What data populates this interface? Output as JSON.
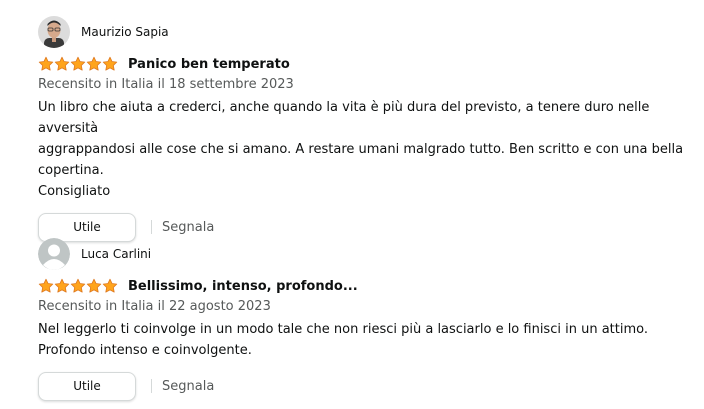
{
  "colors": {
    "star": "#ffa41c",
    "text": "#0f1111",
    "muted": "#565959",
    "button_border": "#d5d9d9"
  },
  "reviews": [
    {
      "author": "Maurizio Sapia",
      "rating": 5,
      "title": "Panico ben temperato",
      "date": "Recensito in Italia il 18 settembre 2023",
      "body_lines": [
        "Un libro che aiuta a crederci, anche quando la vita è più dura del previsto, a tenere duro nelle avversità",
        "aggrappandosi alle cose che si amano. A restare umani malgrado tutto. Ben scritto e con una bella",
        "copertina.",
        "Consigliato"
      ],
      "helpful_label": "Utile",
      "report_label": "Segnala"
    },
    {
      "author": "Luca Carlini",
      "rating": 5,
      "title": "Bellissimo, intenso, profondo...",
      "date": "Recensito in Italia il 22 agosto 2023",
      "body_lines": [
        "Nel leggerlo ti coinvolge in un modo tale che non riesci più a lasciarlo e lo finisci in un attimo.",
        "Profondo intenso e coinvolgente."
      ],
      "helpful_label": "Utile",
      "report_label": "Segnala"
    }
  ]
}
